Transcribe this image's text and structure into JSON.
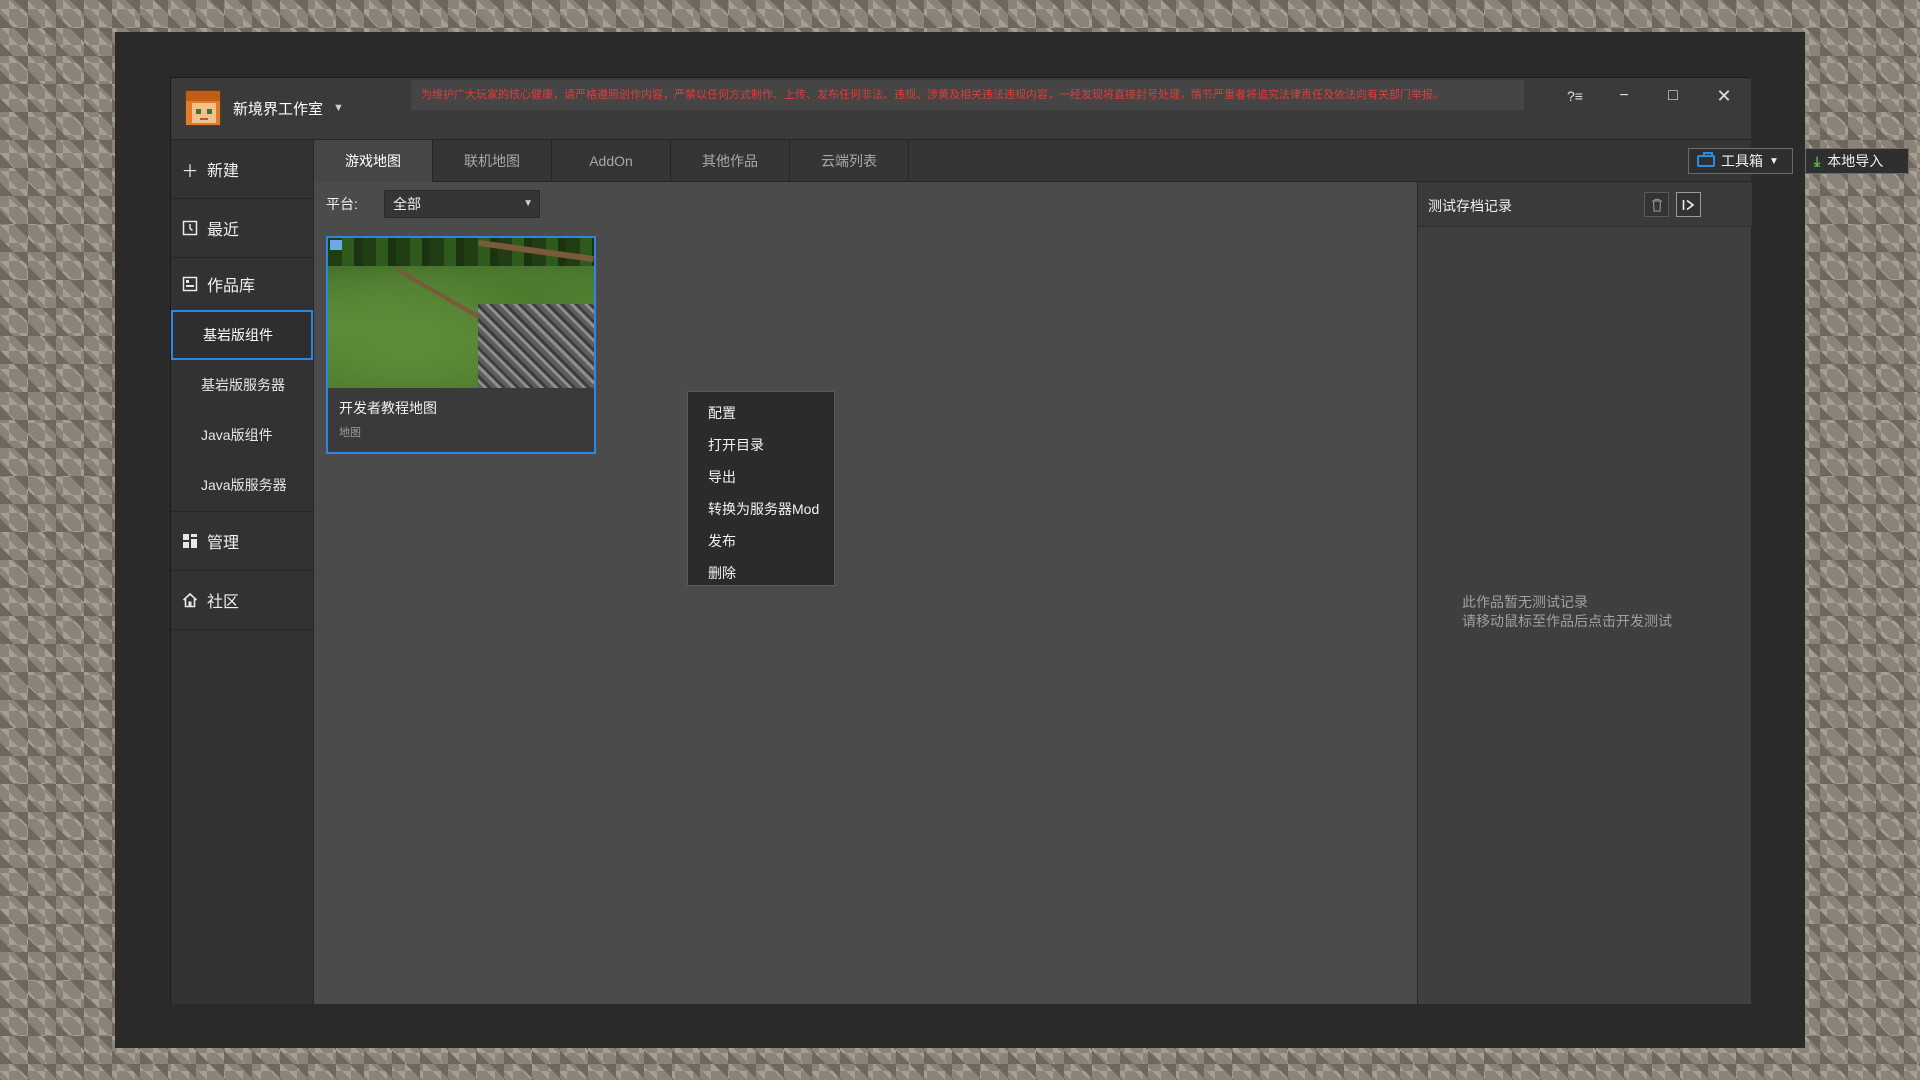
{
  "app": {
    "brand_name": "新境界工作室",
    "notice": "为维护广大玩家的核心健康，请严格遵照创作内容，严禁以任何方式制作、上传、发布任何非法、违规、涉黄及相关违法违规内容，一经发现将直接封号处理，情节严重者将追究法律责任及依法向有关部门举报。",
    "window_controls": {
      "help": "?≡",
      "minimize": "−",
      "maximize": "□",
      "close": "✕"
    }
  },
  "sidebar": {
    "items": [
      {
        "label": "新建",
        "icon": "plus-icon"
      },
      {
        "label": "最近",
        "icon": "recent-icon"
      },
      {
        "label": "作品库",
        "icon": "library-icon"
      }
    ],
    "sub_items": [
      {
        "label": "基岩版组件",
        "active": true
      },
      {
        "label": "基岩版服务器",
        "active": false
      },
      {
        "label": "Java版组件",
        "active": false
      },
      {
        "label": "Java版服务器",
        "active": false
      }
    ],
    "bottom_items": [
      {
        "label": "管理",
        "icon": "grid-icon"
      },
      {
        "label": "社区",
        "icon": "home-icon"
      }
    ]
  },
  "tabs": [
    {
      "label": "游戏地图",
      "active": true
    },
    {
      "label": "联机地图",
      "active": false
    },
    {
      "label": "AddOn",
      "active": false
    },
    {
      "label": "其他作品",
      "active": false
    },
    {
      "label": "云端列表",
      "active": false
    }
  ],
  "toolbar": {
    "toolbox_label": "工具箱",
    "import_label": "本地导入"
  },
  "filter": {
    "label": "平台:",
    "value": "全部"
  },
  "card": {
    "title": "开发者教程地图",
    "subtitle": "地图"
  },
  "context_menu": [
    "配置",
    "打开目录",
    "导出",
    "转换为服务器Mod",
    "发布",
    "删除"
  ],
  "right_panel": {
    "title": "测试存档记录",
    "empty_line1": "此作品暂无测试记录",
    "empty_line2": "请移动鼠标至作品后点击开发测试"
  },
  "colors": {
    "accent": "#2d86e6",
    "notice_text": "#e23b3b",
    "import_icon": "#5fbf4a"
  }
}
